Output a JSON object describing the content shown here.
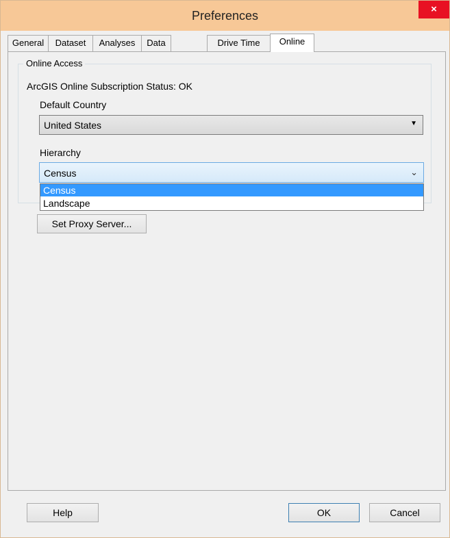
{
  "window": {
    "title": "Preferences",
    "close_glyph": "×"
  },
  "tabs": [
    {
      "label": "General"
    },
    {
      "label": "Dataset"
    },
    {
      "label": "Analyses"
    },
    {
      "label": "Data"
    },
    {
      "label": "Drive Time"
    },
    {
      "label": "Online",
      "active": true
    }
  ],
  "online_access": {
    "group_label": "Online Access",
    "subscription_status": "ArcGIS Online Subscription Status: OK",
    "default_country_label": "Default Country",
    "default_country_value": "United States",
    "hierarchy_label": "Hierarchy",
    "hierarchy_value": "Census",
    "hierarchy_options": [
      "Census",
      "Landscape"
    ],
    "hierarchy_highlighted": "Census",
    "proxy_button": "Set Proxy Server..."
  },
  "footer": {
    "help_label": "Help",
    "ok_label": "OK",
    "cancel_label": "Cancel"
  },
  "icons": {
    "dropdown_arrow": "▼",
    "hierarchy_arrow": "⌄"
  },
  "colors": {
    "titlebar": "#f7c897",
    "close_button": "#e81123",
    "selection": "#3399ff"
  }
}
